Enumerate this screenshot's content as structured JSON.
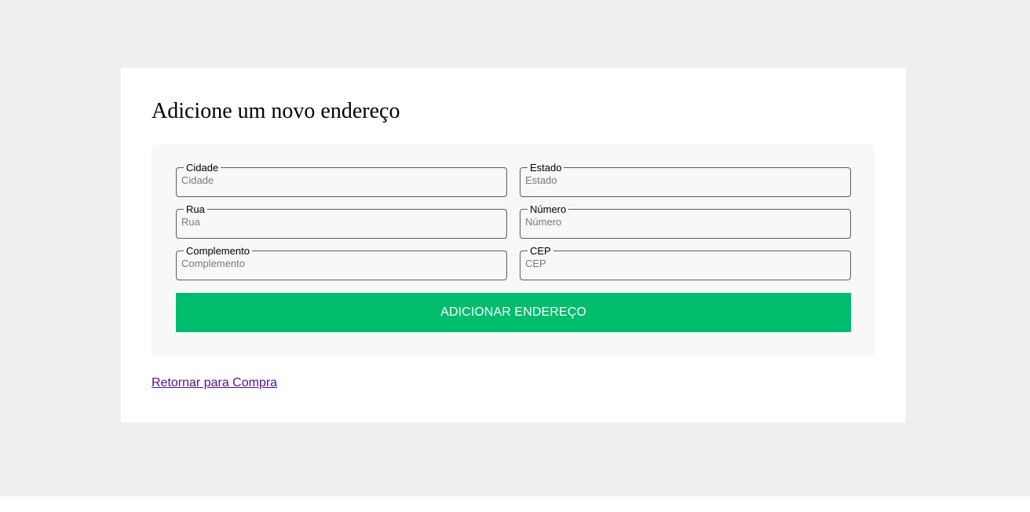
{
  "page": {
    "title": "Adicione um novo endereço"
  },
  "form": {
    "fields": [
      {
        "label": "Cidade",
        "placeholder": "Cidade",
        "value": ""
      },
      {
        "label": "Estado",
        "placeholder": "Estado",
        "value": ""
      },
      {
        "label": "Rua",
        "placeholder": "Rua",
        "value": ""
      },
      {
        "label": "Número",
        "placeholder": "Número",
        "value": ""
      },
      {
        "label": "Complemento",
        "placeholder": "Complemento",
        "value": ""
      },
      {
        "label": "CEP",
        "placeholder": "CEP",
        "value": ""
      }
    ],
    "submit_label": "ADICIONAR ENDEREÇO"
  },
  "links": {
    "back_label": "Retornar para Compra"
  },
  "colors": {
    "page_background": "#efefef",
    "card_background": "#ffffff",
    "form_background": "#f8f8f8",
    "submit_background": "#00bd6d",
    "link": "#5b0f8a"
  }
}
